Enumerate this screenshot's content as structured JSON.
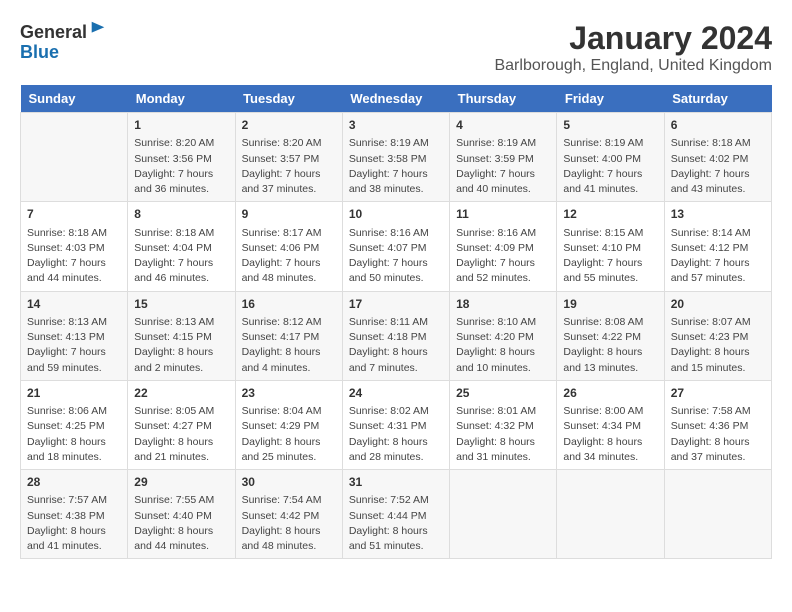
{
  "logo": {
    "general": "General",
    "blue": "Blue"
  },
  "header": {
    "month_title": "January 2024",
    "location": "Barlborough, England, United Kingdom"
  },
  "days_of_week": [
    "Sunday",
    "Monday",
    "Tuesday",
    "Wednesday",
    "Thursday",
    "Friday",
    "Saturday"
  ],
  "weeks": [
    [
      {
        "day": "",
        "info": ""
      },
      {
        "day": "1",
        "info": "Sunrise: 8:20 AM\nSunset: 3:56 PM\nDaylight: 7 hours\nand 36 minutes."
      },
      {
        "day": "2",
        "info": "Sunrise: 8:20 AM\nSunset: 3:57 PM\nDaylight: 7 hours\nand 37 minutes."
      },
      {
        "day": "3",
        "info": "Sunrise: 8:19 AM\nSunset: 3:58 PM\nDaylight: 7 hours\nand 38 minutes."
      },
      {
        "day": "4",
        "info": "Sunrise: 8:19 AM\nSunset: 3:59 PM\nDaylight: 7 hours\nand 40 minutes."
      },
      {
        "day": "5",
        "info": "Sunrise: 8:19 AM\nSunset: 4:00 PM\nDaylight: 7 hours\nand 41 minutes."
      },
      {
        "day": "6",
        "info": "Sunrise: 8:18 AM\nSunset: 4:02 PM\nDaylight: 7 hours\nand 43 minutes."
      }
    ],
    [
      {
        "day": "7",
        "info": "Sunrise: 8:18 AM\nSunset: 4:03 PM\nDaylight: 7 hours\nand 44 minutes."
      },
      {
        "day": "8",
        "info": "Sunrise: 8:18 AM\nSunset: 4:04 PM\nDaylight: 7 hours\nand 46 minutes."
      },
      {
        "day": "9",
        "info": "Sunrise: 8:17 AM\nSunset: 4:06 PM\nDaylight: 7 hours\nand 48 minutes."
      },
      {
        "day": "10",
        "info": "Sunrise: 8:16 AM\nSunset: 4:07 PM\nDaylight: 7 hours\nand 50 minutes."
      },
      {
        "day": "11",
        "info": "Sunrise: 8:16 AM\nSunset: 4:09 PM\nDaylight: 7 hours\nand 52 minutes."
      },
      {
        "day": "12",
        "info": "Sunrise: 8:15 AM\nSunset: 4:10 PM\nDaylight: 7 hours\nand 55 minutes."
      },
      {
        "day": "13",
        "info": "Sunrise: 8:14 AM\nSunset: 4:12 PM\nDaylight: 7 hours\nand 57 minutes."
      }
    ],
    [
      {
        "day": "14",
        "info": "Sunrise: 8:13 AM\nSunset: 4:13 PM\nDaylight: 7 hours\nand 59 minutes."
      },
      {
        "day": "15",
        "info": "Sunrise: 8:13 AM\nSunset: 4:15 PM\nDaylight: 8 hours\nand 2 minutes."
      },
      {
        "day": "16",
        "info": "Sunrise: 8:12 AM\nSunset: 4:17 PM\nDaylight: 8 hours\nand 4 minutes."
      },
      {
        "day": "17",
        "info": "Sunrise: 8:11 AM\nSunset: 4:18 PM\nDaylight: 8 hours\nand 7 minutes."
      },
      {
        "day": "18",
        "info": "Sunrise: 8:10 AM\nSunset: 4:20 PM\nDaylight: 8 hours\nand 10 minutes."
      },
      {
        "day": "19",
        "info": "Sunrise: 8:08 AM\nSunset: 4:22 PM\nDaylight: 8 hours\nand 13 minutes."
      },
      {
        "day": "20",
        "info": "Sunrise: 8:07 AM\nSunset: 4:23 PM\nDaylight: 8 hours\nand 15 minutes."
      }
    ],
    [
      {
        "day": "21",
        "info": "Sunrise: 8:06 AM\nSunset: 4:25 PM\nDaylight: 8 hours\nand 18 minutes."
      },
      {
        "day": "22",
        "info": "Sunrise: 8:05 AM\nSunset: 4:27 PM\nDaylight: 8 hours\nand 21 minutes."
      },
      {
        "day": "23",
        "info": "Sunrise: 8:04 AM\nSunset: 4:29 PM\nDaylight: 8 hours\nand 25 minutes."
      },
      {
        "day": "24",
        "info": "Sunrise: 8:02 AM\nSunset: 4:31 PM\nDaylight: 8 hours\nand 28 minutes."
      },
      {
        "day": "25",
        "info": "Sunrise: 8:01 AM\nSunset: 4:32 PM\nDaylight: 8 hours\nand 31 minutes."
      },
      {
        "day": "26",
        "info": "Sunrise: 8:00 AM\nSunset: 4:34 PM\nDaylight: 8 hours\nand 34 minutes."
      },
      {
        "day": "27",
        "info": "Sunrise: 7:58 AM\nSunset: 4:36 PM\nDaylight: 8 hours\nand 37 minutes."
      }
    ],
    [
      {
        "day": "28",
        "info": "Sunrise: 7:57 AM\nSunset: 4:38 PM\nDaylight: 8 hours\nand 41 minutes."
      },
      {
        "day": "29",
        "info": "Sunrise: 7:55 AM\nSunset: 4:40 PM\nDaylight: 8 hours\nand 44 minutes."
      },
      {
        "day": "30",
        "info": "Sunrise: 7:54 AM\nSunset: 4:42 PM\nDaylight: 8 hours\nand 48 minutes."
      },
      {
        "day": "31",
        "info": "Sunrise: 7:52 AM\nSunset: 4:44 PM\nDaylight: 8 hours\nand 51 minutes."
      },
      {
        "day": "",
        "info": ""
      },
      {
        "day": "",
        "info": ""
      },
      {
        "day": "",
        "info": ""
      }
    ]
  ]
}
